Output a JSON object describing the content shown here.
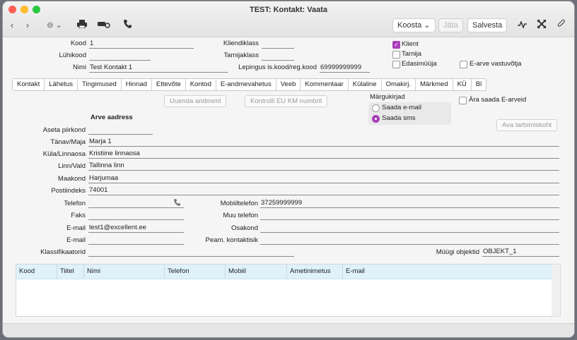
{
  "window": {
    "title": "TEST: Kontakt: Vaata"
  },
  "toolbar": {
    "koosta": "Koosta ⌄",
    "jata": "Jäta",
    "salvesta": "Salvesta"
  },
  "header": {
    "kood_label": "Kood",
    "kood_value": "1",
    "luhikood_label": "Lühikood",
    "luhikood_value": "",
    "nimi_label": "Nimi",
    "nimi_value": "Test Kontakt 1",
    "kliendiklass_label": "Kliendiklass",
    "kliendiklass_value": "",
    "tarnijaklass_label": "Tarnijaklass",
    "tarnijaklass_value": "",
    "lepingus_label": "Lepingus is.kood/reg.kood",
    "lepingus_value": "69999999999",
    "klient_label": "Klient",
    "tarnija_label": "Tarnija",
    "edasimuuja_label": "Edasimüüja",
    "earve_label": "E-arve vastuvõtja"
  },
  "tabs": [
    "Kontakt",
    "Lähetus",
    "Tingimused",
    "Hinnad",
    "Ettevõte",
    "Kontod",
    "E-andmevahetus",
    "Veeb",
    "Kommentaar",
    "Külaline",
    "Omakirj.",
    "Märkmed",
    "KÜ",
    "Bl"
  ],
  "buttons": {
    "uuenda": "Uuenda andmeid",
    "kontrolli": "Kontrolli EU KM numbrit",
    "tarbimiskoht": "Ava tarbimiskoht"
  },
  "margukirjad": {
    "label": "Märgukirjad",
    "email": "Saada e-mail",
    "sms": "Saada sms"
  },
  "ara_saada": "Ära saada E-arveid",
  "address": {
    "heading": "Arve aadress",
    "piirkond_label": "Aseta piirkond",
    "piirkond_value": "",
    "tanav_label": "Tänav/Maja",
    "tanav_value": "Marja 1",
    "kula_label": "Küla/Linnaosa",
    "kula_value": "Kristiine linnaosa",
    "linn_label": "Linn/Vald",
    "linn_value": "Tallinna linn",
    "maakond_label": "Maakond",
    "maakond_value": "Harjumaa",
    "postiindeks_label": "Postiindeks",
    "postiindeks_value": "74001"
  },
  "contact": {
    "telefon_label": "Telefon",
    "telefon_value": "",
    "faks_label": "Faks",
    "faks_value": "",
    "email_label": "E-mail",
    "email_value": "test1@excellent.ee",
    "email2_label": "E-mail",
    "email2_value": "",
    "mobiil_label": "Mobiiltelefon",
    "mobiil_value": "37259999999",
    "muu_label": "Muu telefon",
    "muu_value": "",
    "osakond_label": "Osakond",
    "osakond_value": "",
    "peam_label": "Peam. kontaktisik",
    "peam_value": ""
  },
  "klassifikaatorid_label": "Klassifikaatorid",
  "klassifikaatorid_value": "",
  "muugi_label": "Müügi objektid",
  "muugi_value": "OBJEKT_1",
  "grid": {
    "columns": [
      "Kood",
      "Tiitel",
      "Nimi",
      "Telefon",
      "Mobiil",
      "Ametinimetus",
      "E-mail"
    ]
  }
}
